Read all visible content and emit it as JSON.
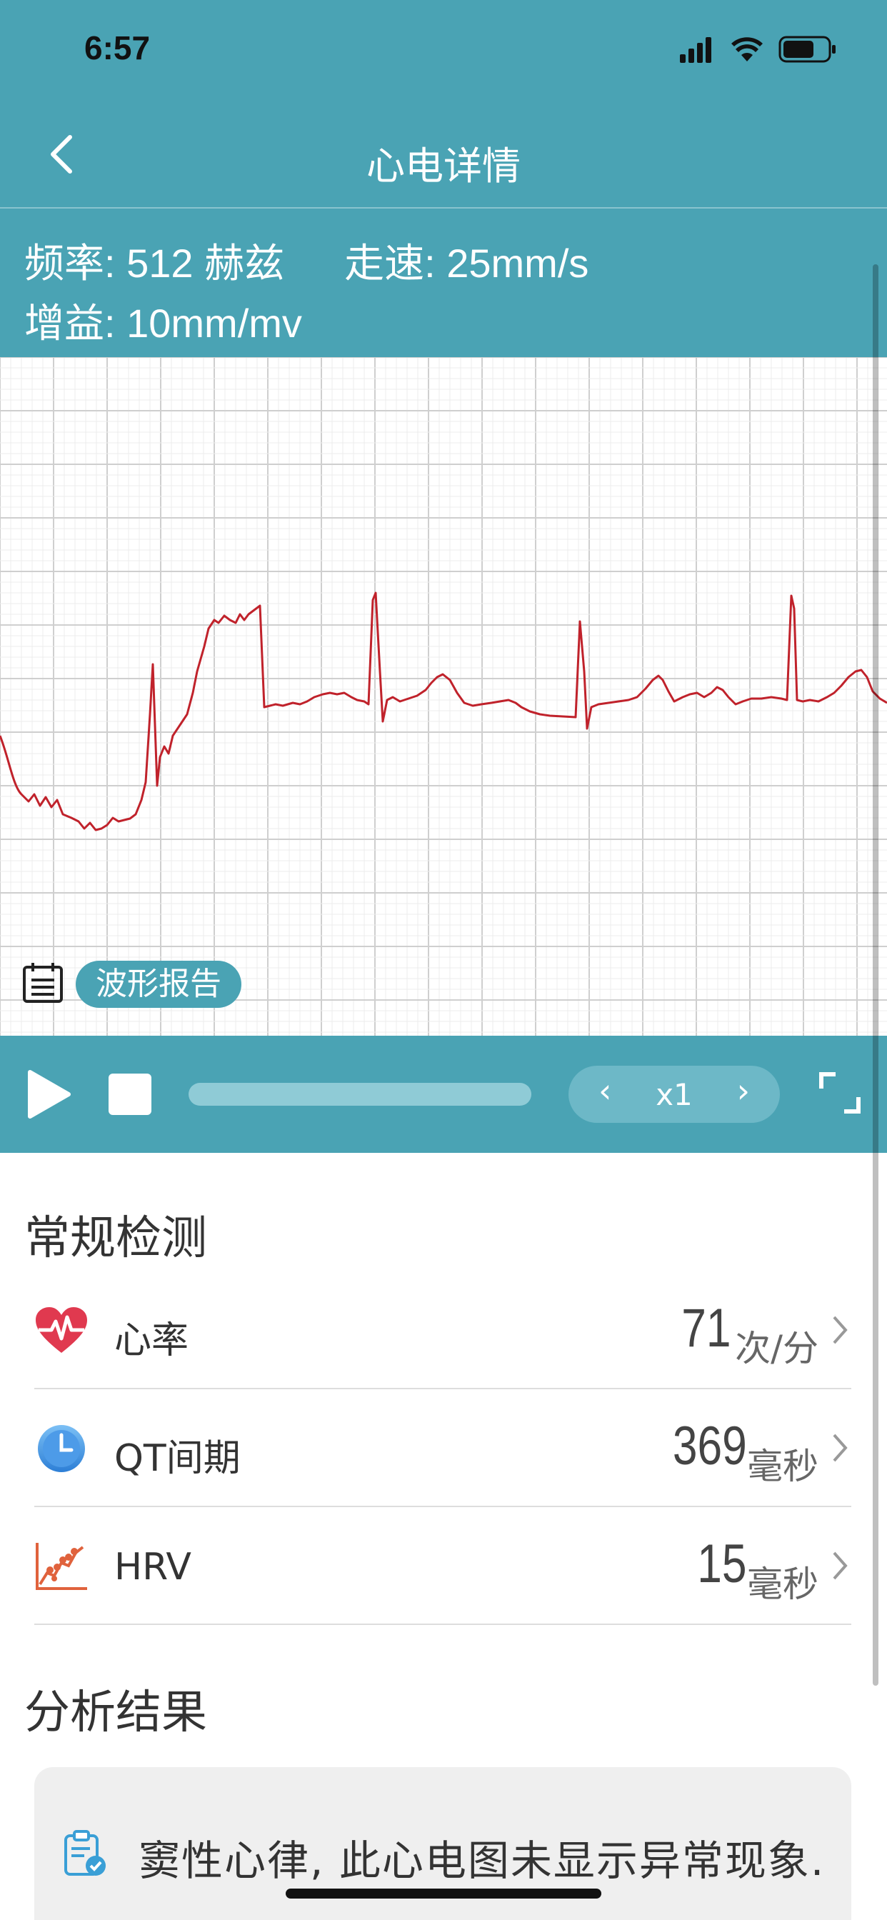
{
  "status_bar": {
    "time": "6:57"
  },
  "nav": {
    "title": "心电详情"
  },
  "ecg_info": {
    "frequency": "频率: 512 赫兹",
    "speed": "走速: 25mm/s",
    "gain": "增益: 10mm/mv"
  },
  "report": {
    "label": "波形报告"
  },
  "player": {
    "speed_value": "x1",
    "prev_label": "‹",
    "next_label": "›"
  },
  "regular": {
    "title": "常规检测",
    "items": [
      {
        "label": "心率",
        "value": "71",
        "unit": "次/分",
        "icon": "heart-rate-icon"
      },
      {
        "label": "QT间期",
        "value": "369",
        "unit": "毫秒",
        "icon": "clock-icon"
      },
      {
        "label": "HRV",
        "value": "15",
        "unit": "毫秒",
        "icon": "hrv-chart-icon"
      }
    ]
  },
  "analysis": {
    "title": "分析结果",
    "result": "窦性心律, 此心电图未显示异常现象."
  },
  "colors": {
    "primary": "#4aa3b4",
    "ecg_line": "#c0222b",
    "grid_major": "#cfcfcf",
    "grid_minor": "#ececec"
  }
}
